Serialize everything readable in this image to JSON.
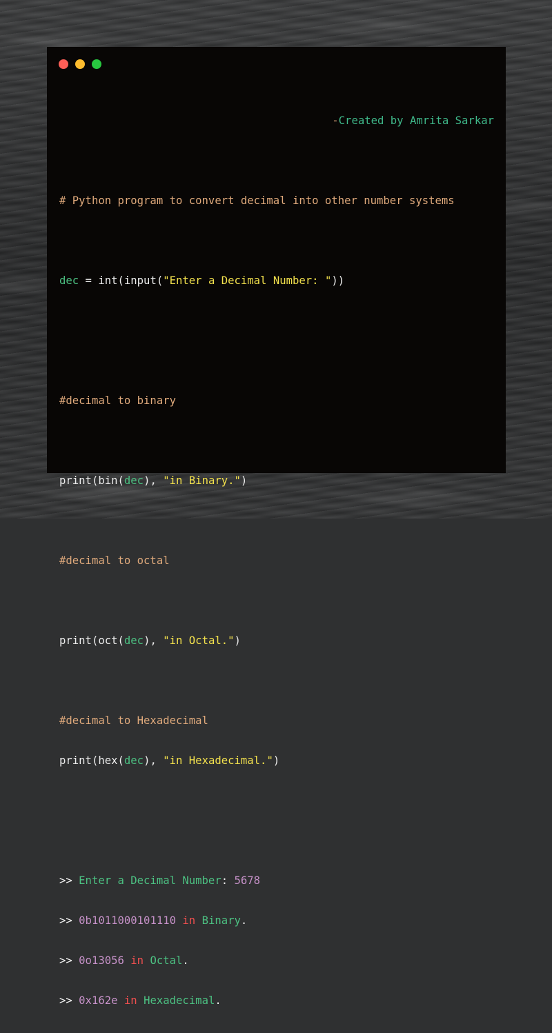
{
  "window": {
    "controls": {
      "close_color": "#fe5f57",
      "minimize_color": "#febc2e",
      "maximize_color": "#28c840"
    }
  },
  "credit": {
    "dash": "-",
    "text": "Created by Amrita Sarkar"
  },
  "code": {
    "comment_header": "# Python program to convert decimal into other number systems",
    "dec_line": {
      "var": "dec",
      "op": " = int(input(",
      "str": "\"Enter a Decimal Number: \"",
      "close": "))"
    },
    "comment_binary": "#decimal to binary",
    "print_bin": {
      "pre": "print(bin(",
      "var": "dec",
      "mid": "), ",
      "str": "\"in Binary.\"",
      "close": ")"
    },
    "comment_octal": "#decimal to octal",
    "print_oct": {
      "pre": "print(oct(",
      "var": "dec",
      "mid": "), ",
      "str": "\"in Octal.\"",
      "close": ")"
    },
    "comment_hex": "#decimal to Hexadecimal",
    "print_hex": {
      "pre": "print(hex(",
      "var": "dec",
      "mid": "), ",
      "str": "\"in Hexadecimal.\"",
      "close": ")"
    }
  },
  "output": {
    "prompt": ">>",
    "line1": {
      "label": "Enter a Decimal Number",
      "colon": ": ",
      "value": "5678"
    },
    "line2": {
      "value": "0b1011000101110",
      "kw": "in",
      "text": "Binary",
      "dot": "."
    },
    "line3": {
      "value": "0o13056",
      "kw": "in",
      "text": "Octal",
      "dot": "."
    },
    "line4": {
      "value": "0x162e",
      "kw": "in",
      "text": "Hexadecimal",
      "dot": "."
    }
  }
}
